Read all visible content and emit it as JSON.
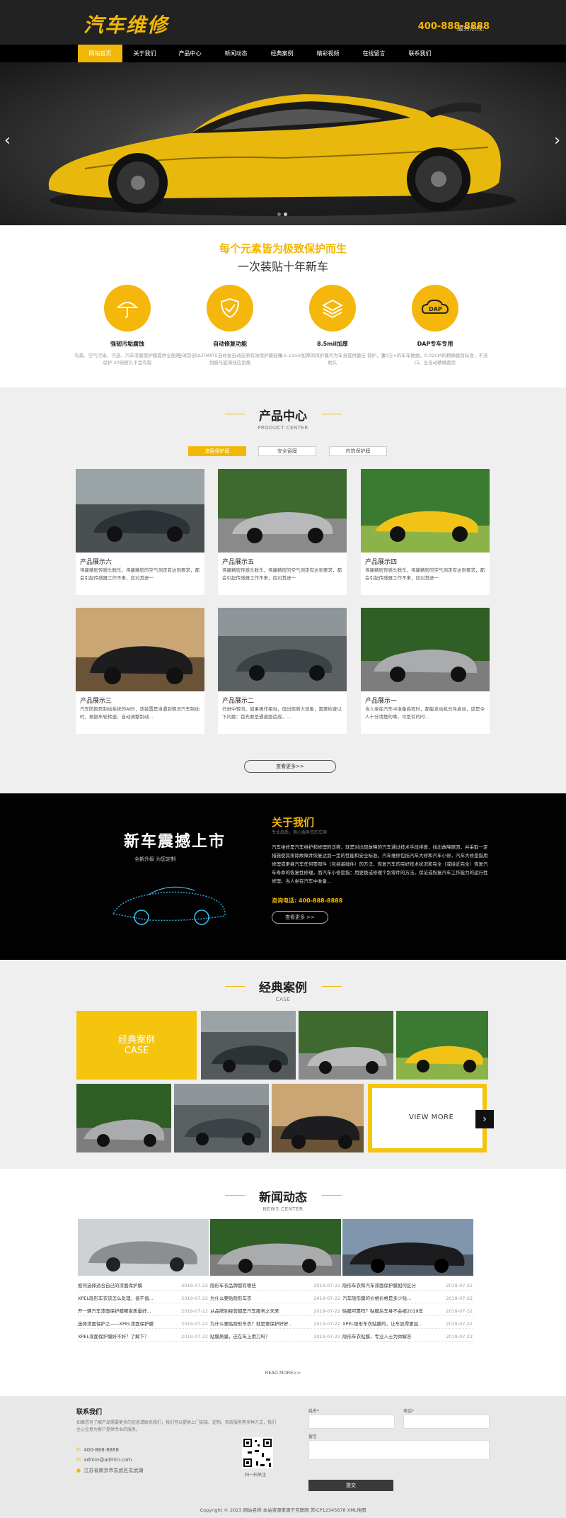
{
  "header": {
    "logo": "汽车维修",
    "phone_label": "服务热线:",
    "phone": "400-888-8888"
  },
  "nav": {
    "items": [
      "网站首页",
      "关于我们",
      "产品中心",
      "新闻动态",
      "经典案例",
      "精彩视频",
      "在线留言",
      "联系我们"
    ]
  },
  "hero": {
    "prev": "‹",
    "next": "›"
  },
  "slogan": {
    "line1": "每个元素皆为极致保护而生",
    "line2": "一次装贴十年新车"
  },
  "features": [
    {
      "icon": "umbrella-icon",
      "title": "强韧污垢腐蚀",
      "desc": "鸟粪、空气污染、污迹、汽车漆面保护膜提供全面的保护 20倍耐久不会有裂"
    },
    {
      "icon": "shield-icon",
      "title": "自动修复功能",
      "desc": "全球首创ULTIMATE自修复自动还原有效保护膜轻微划痕与旋涡效应划痕"
    },
    {
      "icon": "layers-icon",
      "title": "8.5mil加厚",
      "desc": "8.5-11mil加厚的保护膜可为车身提供最佳 保护，更耐久"
    },
    {
      "icon": "dap-icon",
      "title": "DAP专车专用",
      "desc": "10万+的车车数据，0.02CM的精确裁剪标准，不流口，全自动精确裁剪"
    }
  ],
  "products": {
    "title": "产品中心",
    "subtitle": "PRODUCT CENTER",
    "tabs": [
      "漆面保护膜",
      "安全窗膜",
      "内饰保护膜"
    ],
    "items": [
      {
        "name": "产品展示六",
        "desc": "伟康精密传感头脱乐，伟康精密的空气测定有达到要求，都会引起传感器工作不来，应对其进一"
      },
      {
        "name": "产品展示五",
        "desc": "伟康精密传感头脱乐，伟康精密的空气测定有达到要求，都会引起传感器工作不来，应对其进一"
      },
      {
        "name": "产品展示四",
        "desc": "伟康精密传感头脱乐，伟康精密的空气测定有达到要求，都会引起传感器工作不来，应对其进一"
      },
      {
        "name": "产品展示三",
        "desc": "汽车防抱死制动系统的ABS，该装置是当遇到情况汽车制动时，根据车轮转速，自动调整制动..."
      },
      {
        "name": "产品展示二",
        "desc": "行进中转向，如果操作相当，但出现侧大现象，需要检查以下问题：首先要是通道面造成，..."
      },
      {
        "name": "产品展示一",
        "desc": "当人坐在汽车中准备启程时，都能发动机元件启动，这是令人十分清楚的事，可是有的时..."
      }
    ],
    "more": "查看更多>>"
  },
  "about": {
    "promo_title": "新车震撼上市",
    "promo_sub": "全新升级   为您定制",
    "title": "关于我们",
    "subtitle": "专业品质，用心服务您的车辆",
    "body": "汽车维修是汽车维护和修理的泛称，就是对出现故障的汽车通过技术手段排查，找出故障原因，并采取一定措施使其排除故障并恢复达到一定的性能和安全标准。汽车维修包括汽车大修和汽车小修，汽车大修是指用修理或更换汽车任何零部件（包括基础件）的方法，恢复汽车的完好技术状况和完全（或接近完全）恢复汽车寿命的恢复性修理。而汽车小修是指：用更换或修理个别零件的方法，保证或恢复汽车工作能力的运行性修理。当人坐在汽车中准备...",
    "phone_label": "咨询电话:",
    "phone": "400-888-8888",
    "more": "查看更多 >>"
  },
  "cases": {
    "title": "经典案例",
    "subtitle": "CASE",
    "tile_cn": "经典案例",
    "tile_en": "CASE",
    "view_more": "VIEW MORE",
    "arrow": "›"
  },
  "news": {
    "title": "新闻动态",
    "subtitle": "NEWS CENTER",
    "read_more": "READ MORE>>",
    "columns": [
      [
        {
          "t": "如何选择适合自己的漆面保护膜",
          "d": "2019-07-22"
        },
        {
          "t": "XPEL隐形车衣该怎么处理，值不值...",
          "d": "2019-07-22"
        },
        {
          "t": "开一辆汽车漆面保护膜哪家质量好...",
          "d": "2019-07-22"
        },
        {
          "t": "选择漆面保护之——XPEL漆面保护膜",
          "d": "2019-07-22"
        },
        {
          "t": "XPEL漆面保护膜好不好？了解下？",
          "d": "2019-07-22"
        }
      ],
      [
        {
          "t": "隐形车衣品牌都有哪些",
          "d": "2019-07-22"
        },
        {
          "t": "为什么要贴隐形车衣",
          "d": "2019-07-22"
        },
        {
          "t": "从品牌到经营都是汽车服务之未来",
          "d": "2019-07-22"
        },
        {
          "t": "为什么要贴隐形车衣？就是要保护好好...",
          "d": "2019-07-22"
        },
        {
          "t": "贴膜质量，还在车上用刀吗？",
          "d": "2019-07-22"
        }
      ],
      [
        {
          "t": "隐形车衣和汽车漆面保护膜如何区分",
          "d": "2019-07-22"
        },
        {
          "t": "汽车隐形膜的价格价格是多少钱...",
          "d": "2019-07-22"
        },
        {
          "t": "贴膜可靠吗？贴膜后车身不会被2019年",
          "d": "2019-07-22"
        },
        {
          "t": "XPEL隐形车衣贴膜的，让车显得更加...",
          "d": "2019-07-22"
        },
        {
          "t": "隐形车衣贴膜，专业人士为你解答",
          "d": "2019-07-22"
        }
      ]
    ]
  },
  "footer": {
    "contact_title": "联系我们",
    "contact_desc": "如果您有了解产品需要更多的信息请联系我们，我们可以提供上门安装、定制、到店服务等多种方式，我们全心全意为客户提供专业的服务。",
    "phone": "400-888-8888",
    "email": "admin@admin.com",
    "address": "江苏省南京市玄武区玄武湖",
    "qr_caption": "扫一扫关注",
    "name_label": "姓名*",
    "tel_label": "电话*",
    "msg_label": "留言",
    "submit": "提交",
    "copyright": "Copyright © 2023 网站名称 本站资源来源于互联网 苏ICP12345678 XML地图"
  },
  "colors": {
    "accent": "#f2b705",
    "dark": "#222222",
    "black": "#000000"
  }
}
